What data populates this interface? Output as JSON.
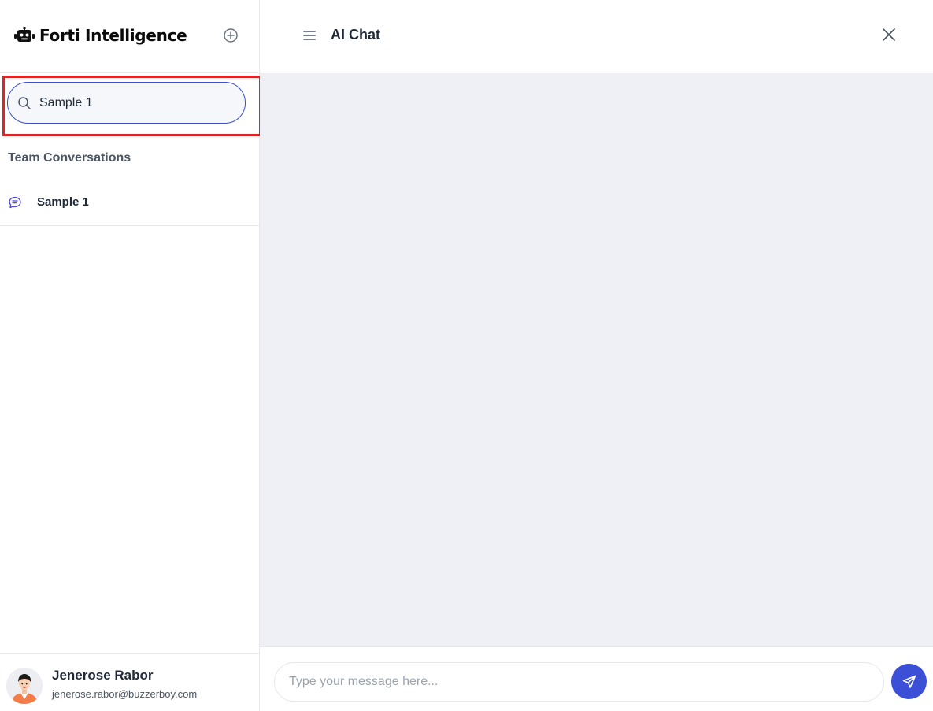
{
  "sidebar": {
    "brand_title": "Forti Intelligence",
    "search": {
      "value": "Sample 1",
      "placeholder": ""
    },
    "section_title": "Team Conversations",
    "conversations": [
      {
        "label": "Sample 1"
      }
    ],
    "profile": {
      "name": "Jenerose Rabor",
      "email": "jenerose.rabor@buzzerboy.com"
    }
  },
  "header": {
    "title": "AI Chat"
  },
  "composer": {
    "placeholder": "Type your message here..."
  },
  "icons": {
    "brand": "robot-icon",
    "new_chat": "plus-circle-icon",
    "search": "search-icon",
    "conversation": "chat-bubble-icon",
    "menu": "hamburger-menu-icon",
    "close": "close-icon",
    "send": "send-icon"
  },
  "colors": {
    "accent": "#3b50d6",
    "highlight": "#dc2626",
    "chat_background": "#eff0f5",
    "search_border": "#3b50c8"
  }
}
